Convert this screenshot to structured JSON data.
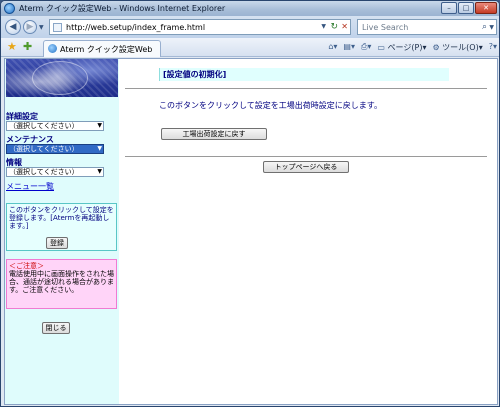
{
  "window": {
    "title": "Aterm クイック設定Web - Windows Internet Explorer",
    "controls": {
      "minimize": "–",
      "maximize": "□",
      "close": "✕"
    }
  },
  "navbar": {
    "url": "http://web.setup/index_frame.html",
    "search_placeholder": "Live Search"
  },
  "tab": {
    "label": "Aterm クイック設定Web"
  },
  "commands": {
    "page": "ページ(P)",
    "tools": "ツール(O)"
  },
  "sidebar": {
    "groups": [
      {
        "label": "詳細設定",
        "select_value": "（選択してください）"
      },
      {
        "label": "メンテナンス",
        "select_value": "（選択してください）"
      },
      {
        "label": "情報",
        "select_value": "（選択してください）"
      }
    ],
    "menu_list_link": "メニュー一覧",
    "info_text": "このボタンをクリックして設定を登録します。[Atermを再起動します。]",
    "register_button": "登録",
    "caution_title": "＜ご注意＞",
    "caution_text": "電話使用中に画面操作をされた場合、通話が途切れる場合があります。ご注意ください。",
    "close_button": "閉じる"
  },
  "main": {
    "heading": "[設定値の初期化]",
    "description": "このボタンをクリックして設定を工場出荷時設定に戻します。",
    "reset_button": "工場出荷設定に戻す",
    "top_button": "トップページへ戻る"
  },
  "colors": {
    "sidebar_bg": "#dffcfc",
    "heading_bg": "#e0fffe",
    "caution_bg": "#ffd4f8",
    "text_navy": "#000080",
    "selected_blue": "#316ac5"
  }
}
